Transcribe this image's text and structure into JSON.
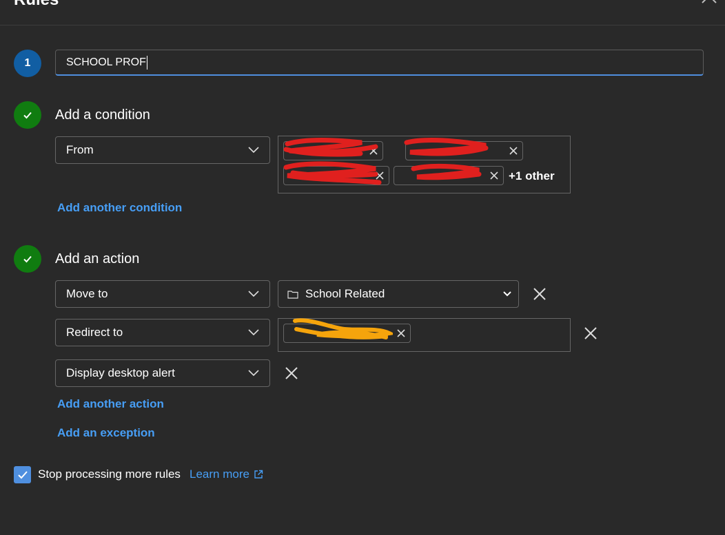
{
  "header": {
    "title": "Rules"
  },
  "step1": {
    "number": "1",
    "rule_name_value": "SCHOOL PROF"
  },
  "condition": {
    "title": "Add a condition",
    "field": "From",
    "recipients": [
      "",
      "",
      "",
      ""
    ],
    "more_label": "+1 other",
    "add_label": "Add another condition"
  },
  "action": {
    "title": "Add an action",
    "rows": [
      {
        "type": "Move to",
        "folder": "School Related",
        "folder_icon": "folder-icon"
      },
      {
        "type": "Redirect to",
        "recipients": [
          ""
        ]
      },
      {
        "type": "Display desktop alert"
      }
    ],
    "add_label": "Add another action",
    "exception_label": "Add an exception"
  },
  "footer": {
    "stop_processing_label": "Stop processing more rules",
    "stop_processing_checked": true,
    "learn_more_label": "Learn more"
  },
  "colors": {
    "background": "#292929",
    "accent": "#479ef5",
    "step_blue": "#115ea3",
    "step_green": "#107c10",
    "redaction_red": "#e0201e",
    "redaction_orange": "#f5a40c"
  }
}
